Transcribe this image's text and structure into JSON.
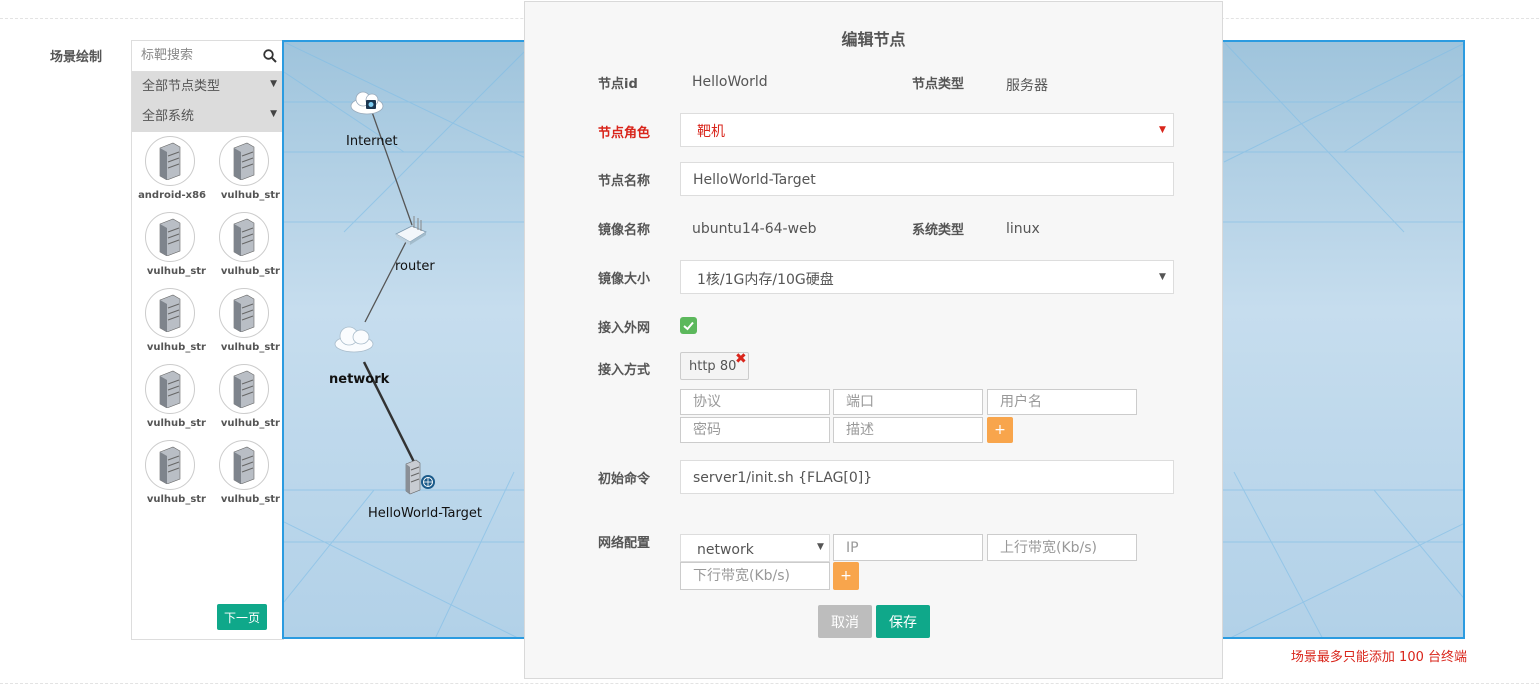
{
  "section_label": "场景绘制",
  "palette": {
    "search_placeholder": "标靶搜索",
    "filter_node_type": "全部节点类型",
    "filter_system": "全部系统",
    "nodes": [
      "android-x86",
      "vulhub_str",
      "vulhub_str",
      "vulhub_str",
      "vulhub_str",
      "vulhub_str",
      "vulhub_str",
      "vulhub_str",
      "vulhub_str",
      "vulhub_str"
    ],
    "next_page": "下一页"
  },
  "canvas": {
    "nodes": {
      "internet": "Internet",
      "router": "router",
      "network": "network",
      "target": "HelloWorld-Target"
    },
    "limit_note": "场景最多只能添加 100 台终端"
  },
  "modal": {
    "title": "编辑节点",
    "node_id_label": "节点id",
    "node_id_value": "HelloWorld",
    "node_type_label": "节点类型",
    "node_type_value": "服务器",
    "node_role_label": "节点角色",
    "node_role_value": "靶机",
    "node_name_label": "节点名称",
    "node_name_value": "HelloWorld-Target",
    "image_name_label": "镜像名称",
    "image_name_value": "ubuntu14-64-web",
    "system_type_label": "系统类型",
    "system_type_value": "linux",
    "image_size_label": "镜像大小",
    "image_size_value": "1核/1G内存/10G硬盘",
    "external_net_label": "接入外网",
    "access_mode_label": "接入方式",
    "access_tag": "http 80",
    "access_placeholders": {
      "protocol": "协议",
      "port": "端口",
      "username": "用户名",
      "password": "密码",
      "description": "描述"
    },
    "init_cmd_label": "初始命令",
    "init_cmd_value": "server1/init.sh {FLAG[0]}",
    "network_config_label": "网络配置",
    "network_select_value": "network",
    "network_placeholders": {
      "ip": "IP",
      "up_bw": "上行带宽(Kb/s)",
      "down_bw": "下行带宽(Kb/s)"
    },
    "plus": "+",
    "cancel": "取消",
    "save": "保存"
  },
  "colors": {
    "accent_green": "#0fa88a",
    "required_red": "#d9251b",
    "add_orange": "#f8a54c",
    "canvas_border": "#2b9be0"
  }
}
